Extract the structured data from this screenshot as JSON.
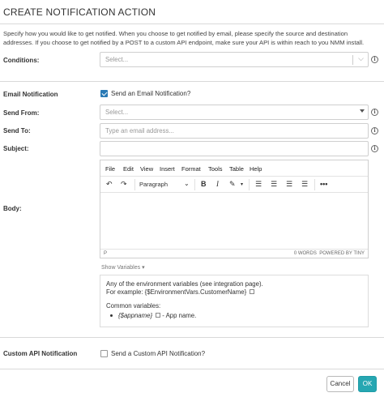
{
  "dialog": {
    "title": "CREATE NOTIFICATION ACTION",
    "description": "Specify how you would like to get notified. When you choose to get notified by email, please specify the source and destination addresses. If you choose to get notified by a POST to a custom API endpoint, make sure your API is within reach to you NMM install."
  },
  "conditions": {
    "label": "Conditions:",
    "placeholder": "Select..."
  },
  "email": {
    "label": "Email Notification",
    "checkbox_label": "Send an Email Notification?",
    "checked": true
  },
  "send_from": {
    "label": "Send From:",
    "placeholder": "Select..."
  },
  "send_to": {
    "label": "Send To:",
    "placeholder": "Type an email address..."
  },
  "subject": {
    "label": "Subject:",
    "value": ""
  },
  "body": {
    "label": "Body:",
    "menu": [
      "File",
      "Edit",
      "View",
      "Insert",
      "Format",
      "Tools",
      "Table",
      "Help"
    ],
    "block_format": "Paragraph",
    "status_path": "P",
    "status_words": "0 WORDS",
    "status_powered": "POWERED BY TINY"
  },
  "variables": {
    "toggle_label": "Show Variables",
    "line1": "Any of the environment variables (see integration page).",
    "line2": "For example: {$EnvironmentVars.CustomerName}",
    "common_label": "Common variables:",
    "item_var": "{$appname}",
    "item_desc": "- App name."
  },
  "custom_api": {
    "label": "Custom API Notification",
    "checkbox_label": "Send a Custom API Notification?",
    "checked": false
  },
  "buttons": {
    "cancel": "Cancel",
    "ok": "OK"
  },
  "colors": {
    "ok_bg": "#26a7b2",
    "checkbox_checked": "#2a7ab5"
  }
}
